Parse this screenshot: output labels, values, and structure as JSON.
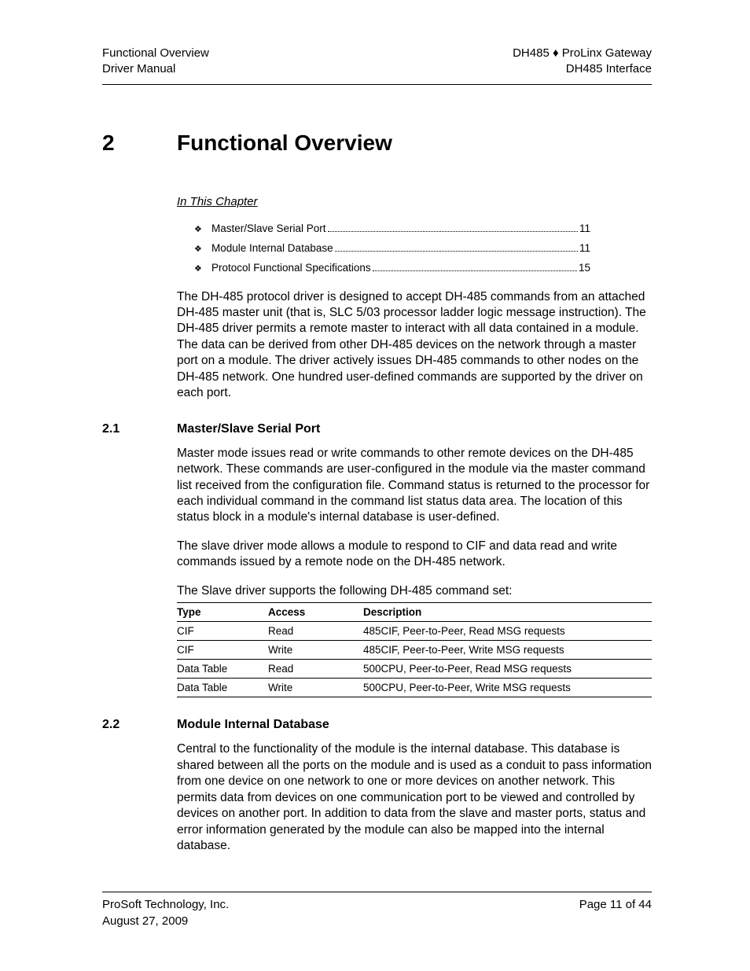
{
  "header": {
    "left1": "Functional Overview",
    "left2": "Driver Manual",
    "right1": "DH485 ♦ ProLinx Gateway",
    "right2": "DH485 Interface"
  },
  "chapter": {
    "number": "2",
    "title": "Functional Overview"
  },
  "inThisChapter": "In This Chapter",
  "toc": [
    {
      "label": "Master/Slave Serial Port",
      "page": "11"
    },
    {
      "label": "Module Internal Database",
      "page": "11"
    },
    {
      "label": "Protocol Functional Specifications",
      "page": "15"
    }
  ],
  "introPara": "The DH-485 protocol driver is designed to accept DH-485 commands from an attached DH-485 master unit (that is, SLC 5/03 processor ladder logic message instruction). The DH-485 driver permits a remote master to interact with all data contained in a module. The data can be derived from other DH-485 devices on the network through a master port on a module. The driver actively issues DH-485 commands to other nodes on the DH-485 network. One hundred user-defined commands are supported by the driver on each port.",
  "section21": {
    "num": "2.1",
    "title": "Master/Slave Serial Port",
    "para1": "Master mode issues read or write commands to other remote devices on the DH-485 network. These commands are user-configured in the module via the master command list received from the configuration file. Command status is returned to the processor for each individual command in the command list status data area. The location of this status block in a module's internal database is user-defined.",
    "para2": "The slave driver mode allows a module to respond to CIF and data read and write commands issued by a remote node on the DH-485 network.",
    "para3": "The Slave driver supports the following DH-485 command set:"
  },
  "table": {
    "headers": {
      "type": "Type",
      "access": "Access",
      "desc": "Description"
    },
    "rows": [
      {
        "type": "CIF",
        "access": "Read",
        "desc": "485CIF, Peer-to-Peer, Read MSG requests"
      },
      {
        "type": "CIF",
        "access": "Write",
        "desc": "485CIF, Peer-to-Peer, Write MSG requests"
      },
      {
        "type": "Data Table",
        "access": "Read",
        "desc": "500CPU, Peer-to-Peer, Read MSG requests"
      },
      {
        "type": "Data Table",
        "access": "Write",
        "desc": "500CPU, Peer-to-Peer, Write MSG requests"
      }
    ]
  },
  "section22": {
    "num": "2.2",
    "title": "Module Internal Database",
    "para1": "Central to the functionality of the module is the internal database. This database is shared between all the ports on the module and is used as a conduit to pass information from one device on one network to one or more devices on another network. This permits data from devices on one communication port to be viewed and controlled by devices on another port. In addition to data from the slave and master ports, status and error information generated by the module can also be mapped into the internal database."
  },
  "footer": {
    "left1": "ProSoft Technology, Inc.",
    "left2": "August 27, 2009",
    "right1": "Page 11 of 44"
  }
}
